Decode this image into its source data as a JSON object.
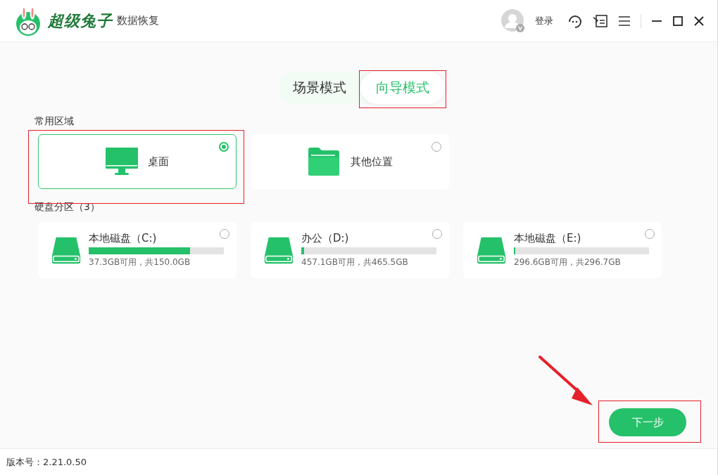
{
  "app": {
    "brand": "超级兔子",
    "product": "数据恢复"
  },
  "header": {
    "login": "登录"
  },
  "modes": [
    {
      "label": "场景模式",
      "selected": false
    },
    {
      "label": "向导模式",
      "selected": true
    }
  ],
  "common_area": {
    "title": "常用区域",
    "items": [
      {
        "kind": "desktop",
        "label": "桌面",
        "selected": true
      },
      {
        "kind": "folder",
        "label": "其他位置",
        "selected": false
      }
    ]
  },
  "partitions": {
    "title": "硬盘分区（3）",
    "items": [
      {
        "name": "本地磁盘（C:)",
        "level": 0.75,
        "usage": "37.3GB可用，共150.0GB",
        "selected": false
      },
      {
        "name": "办公（D:)",
        "level": 0.02,
        "usage": "457.1GB可用，共465.5GB",
        "selected": false
      },
      {
        "name": "本地磁盘（E:)",
        "level": 0.005,
        "usage": "296.6GB可用，共296.7GB",
        "selected": false
      }
    ]
  },
  "next_button": "下一步",
  "status_bar": {
    "version": "版本号：2.21.0.50"
  }
}
